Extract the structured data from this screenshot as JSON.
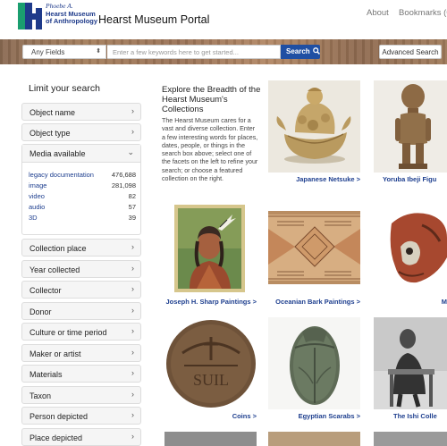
{
  "header": {
    "logo": {
      "line1": "Phoebe A.",
      "line2": "Hearst Museum",
      "line3": "of Anthropology"
    },
    "portal_title": "Hearst Museum Portal",
    "nav": {
      "about": "About",
      "bookmarks": "Bookmarks (0)"
    }
  },
  "search": {
    "field_select": "Any Fields",
    "placeholder": "Enter a few keywords here to get started...",
    "search_label": "Search",
    "advanced_label": "Advanced Search"
  },
  "sidebar": {
    "title": "Limit your search",
    "facets_top": [
      "Object name",
      "Object type"
    ],
    "media": {
      "label": "Media available",
      "rows": [
        {
          "label": "legacy documentation",
          "count": "476,688"
        },
        {
          "label": "image",
          "count": "281,098"
        },
        {
          "label": "video",
          "count": "82"
        },
        {
          "label": "audio",
          "count": "57"
        },
        {
          "label": "3D",
          "count": "39"
        }
      ]
    },
    "facets_bottom": [
      "Collection place",
      "Year collected",
      "Collector",
      "Donor",
      "Culture or time period",
      "Maker or artist",
      "Materials",
      "Taxon",
      "Person depicted",
      "Place depicted"
    ]
  },
  "intro": {
    "title": "Explore the Breadth of the Hearst Museum's Collections",
    "body": "The Hearst Museum cares for a vast and diverse collection. Enter a few interesting words for places, dates, people, or things in the search box above; select one of the facets on the left to refine your search; or choose a featured collection on the right."
  },
  "collections": [
    "Japanese Netsuke >",
    "Yoruba Ibeji Figu",
    "Joseph H. Sharp Paintings >",
    "Oceanian Bark Paintings >",
    "M",
    "Coins >",
    "Egyptian Scarabs >",
    "The Ishi Colle"
  ],
  "colors": {
    "brand_blue": "#1e3a8a",
    "brand_green": "#1a9e6f",
    "search_button": "#1f4fa3",
    "link": "#1e3f8f"
  }
}
